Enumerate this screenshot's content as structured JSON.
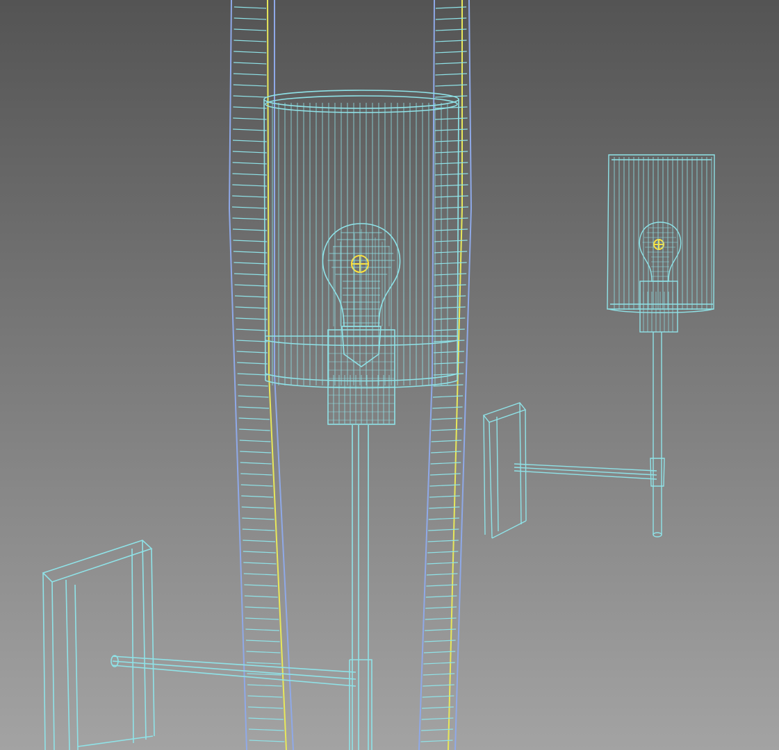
{
  "viewport": {
    "background_top": "#545454",
    "background_bottom": "#a3a3a3"
  },
  "colors": {
    "wire_cyan": "#8fe3e8",
    "wire_blue": "#8fa9e8",
    "wire_yellow": "#e8e85a",
    "pivot_yellow": "#ffe23a"
  },
  "objects": [
    {
      "name": "large-sconce",
      "type": "wireframe-lamp"
    },
    {
      "name": "small-sconce",
      "type": "wireframe-lamp"
    },
    {
      "name": "tall-frame",
      "type": "wireframe-frame"
    }
  ]
}
